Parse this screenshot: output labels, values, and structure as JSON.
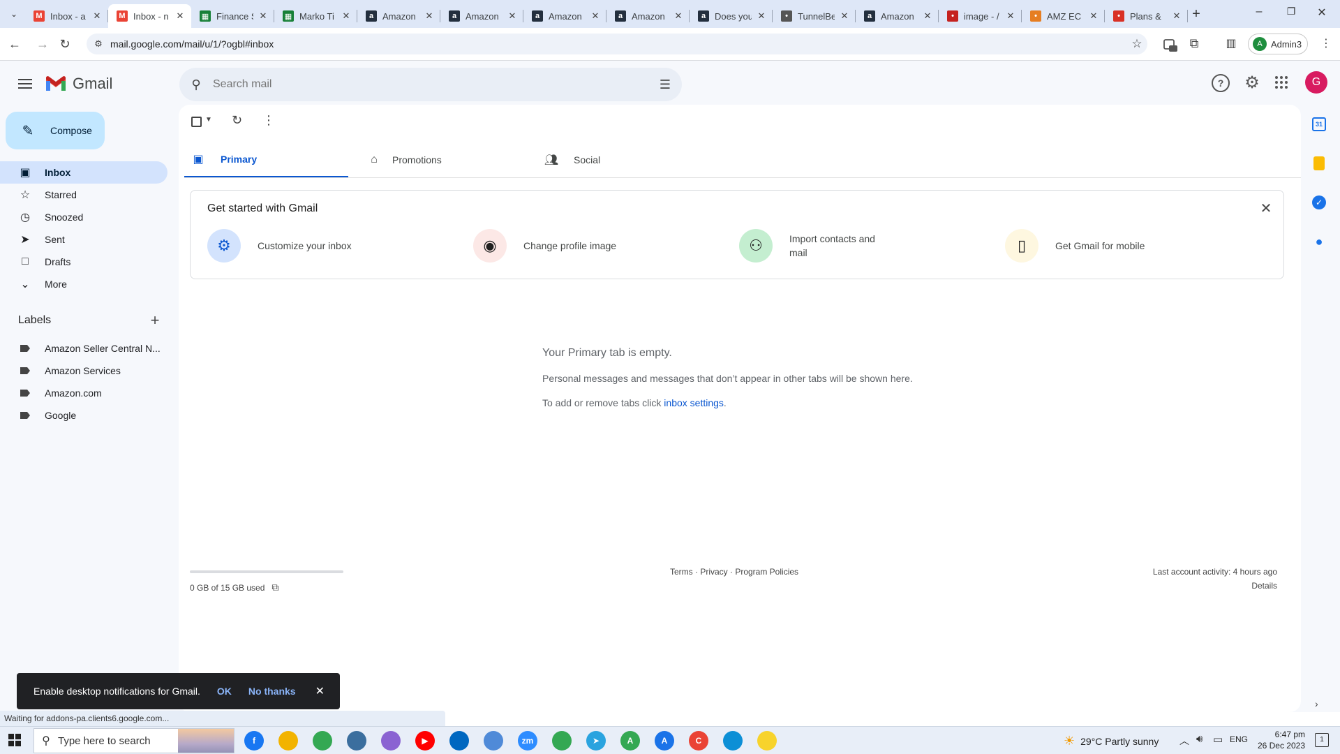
{
  "browser": {
    "tabs": [
      {
        "title": "Inbox - a",
        "icon": "gmail-icon",
        "color": "#ea4335",
        "active": false
      },
      {
        "title": "Inbox - n",
        "icon": "gmail-icon",
        "color": "#ea4335",
        "active": true
      },
      {
        "title": "Finance S",
        "icon": "sheets-icon",
        "color": "#188038",
        "active": false
      },
      {
        "title": "Marko Ti",
        "icon": "sheets-icon",
        "color": "#188038",
        "active": false
      },
      {
        "title": "Amazon",
        "icon": "amazon-icon",
        "color": "#232f3e",
        "active": false
      },
      {
        "title": "Amazon",
        "icon": "amazon-icon",
        "color": "#232f3e",
        "active": false
      },
      {
        "title": "Amazon",
        "icon": "amazon-icon",
        "color": "#232f3e",
        "active": false
      },
      {
        "title": "Amazon",
        "icon": "amazon-icon",
        "color": "#232f3e",
        "active": false
      },
      {
        "title": "Does you",
        "icon": "amazon-icon",
        "color": "#232f3e",
        "active": false
      },
      {
        "title": "TunnelBe",
        "icon": "tunnelbear-icon",
        "color": "#555555",
        "active": false
      },
      {
        "title": "Amazon",
        "icon": "amazon-icon",
        "color": "#232f3e",
        "active": false
      },
      {
        "title": "image - /",
        "icon": "vivaldi-icon",
        "color": "#c5221f",
        "active": false
      },
      {
        "title": "AMZ EC",
        "icon": "amz-icon",
        "color": "#e67e22",
        "active": false
      },
      {
        "title": "Plans & ",
        "icon": "plans-icon",
        "color": "#d93025",
        "active": false
      }
    ],
    "url": "mail.google.com/mail/u/1/?ogbl#inbox",
    "profile_label": "Admin3",
    "profile_initial": "A",
    "status_text": "Waiting for addons-pa.clients6.google.com..."
  },
  "gmail": {
    "logo_text": "Gmail",
    "search_placeholder": "Search mail",
    "avatar_initial": "G",
    "compose_label": "Compose",
    "nav": [
      {
        "label": "Inbox",
        "icon": "inbox-icon",
        "glyph": "▣",
        "active": true
      },
      {
        "label": "Starred",
        "icon": "star-icon",
        "glyph": "☆",
        "active": false
      },
      {
        "label": "Snoozed",
        "icon": "clock-icon",
        "glyph": "◷",
        "active": false
      },
      {
        "label": "Sent",
        "icon": "send-icon",
        "glyph": "➤",
        "active": false
      },
      {
        "label": "Drafts",
        "icon": "draft-icon",
        "glyph": "□",
        "active": false
      },
      {
        "label": "More",
        "icon": "chevron-down-icon",
        "glyph": "⌄",
        "active": false
      }
    ],
    "labels_header": "Labels",
    "labels": [
      "Amazon Seller Central N...",
      "Amazon Services",
      "Amazon.com",
      "Google"
    ],
    "tabs": [
      {
        "label": "Primary",
        "icon": "inbox-icon",
        "active": true
      },
      {
        "label": "Promotions",
        "icon": "tag-icon",
        "active": false
      },
      {
        "label": "Social",
        "icon": "people-icon",
        "active": false
      }
    ],
    "getting_started": {
      "title": "Get started with Gmail",
      "tiles": [
        {
          "label": "Customize your inbox",
          "icon": "gear-icon",
          "bg": "#d3e3fd",
          "fg": "#0b57d0"
        },
        {
          "label": "Change profile image",
          "icon": "account-circle-icon",
          "bg": "#fce8e6",
          "fg": "#1f1f1f"
        },
        {
          "label": "Import contacts and mail",
          "icon": "person-add-icon",
          "bg": "#c4eed0",
          "fg": "#1f1f1f"
        },
        {
          "label": "Get Gmail for mobile",
          "icon": "phone-icon",
          "bg": "#fef7e0",
          "fg": "#1f1f1f"
        }
      ]
    },
    "empty": {
      "heading": "Your Primary tab is empty.",
      "line1": "Personal messages and messages that don’t appear in other tabs will be shown here.",
      "line2_prefix": "To add or remove tabs click ",
      "line2_link": "inbox settings",
      "line2_suffix": "."
    },
    "footer": {
      "storage": "0 GB of 15 GB used",
      "storage_fraction": 0.0,
      "links": "Terms · Privacy · Program Policies",
      "activity": "Last account activity: 4 hours ago",
      "details": "Details"
    },
    "snackbar": {
      "text": "Enable desktop notifications for Gmail.",
      "ok": "OK",
      "no_thanks": "No thanks"
    }
  },
  "taskbar": {
    "search_placeholder": "Type here to search",
    "weather": "29°C  Partly sunny",
    "language": "ENG",
    "time": "6:47 pm",
    "date": "26 Dec 2023",
    "apps": [
      {
        "icon": "facebook-icon",
        "color": "#1877f2",
        "glyph": "f"
      },
      {
        "icon": "file-explorer-icon",
        "color": "#f2b300",
        "glyph": ""
      },
      {
        "icon": "chrome-icon",
        "color": "#34a853",
        "glyph": ""
      },
      {
        "icon": "calculator-icon",
        "color": "#3b6e9e",
        "glyph": ""
      },
      {
        "icon": "copilot-icon",
        "color": "#8a63d2",
        "glyph": ""
      },
      {
        "icon": "youtube-icon",
        "color": "#ff0000",
        "glyph": "▶"
      },
      {
        "icon": "store-icon",
        "color": "#0067c0",
        "glyph": ""
      },
      {
        "icon": "snipping-tool-icon",
        "color": "#4f8ad8",
        "glyph": ""
      },
      {
        "icon": "zoom-icon",
        "color": "#2d8cff",
        "glyph": "zm"
      },
      {
        "icon": "chrome-profile-icon",
        "color": "#34a853",
        "glyph": ""
      },
      {
        "icon": "telegram-icon",
        "color": "#2aa3df",
        "glyph": "➤"
      },
      {
        "icon": "chrome-profile-a-icon",
        "color": "#34a853",
        "glyph": "A"
      },
      {
        "icon": "chrome-profile-b-icon",
        "color": "#1a73e8",
        "glyph": "A"
      },
      {
        "icon": "chrome-profile-c-icon",
        "color": "#ea4335",
        "glyph": "C"
      },
      {
        "icon": "edge-icon",
        "color": "#0c8fd6",
        "glyph": ""
      },
      {
        "icon": "sticky-notes-icon",
        "color": "#f7d32c",
        "glyph": ""
      }
    ]
  },
  "colors": {
    "accent": "#0b57d0",
    "nav_active": "#d3e3fd",
    "compose": "#c2e7ff",
    "snackbar": "#202124"
  }
}
